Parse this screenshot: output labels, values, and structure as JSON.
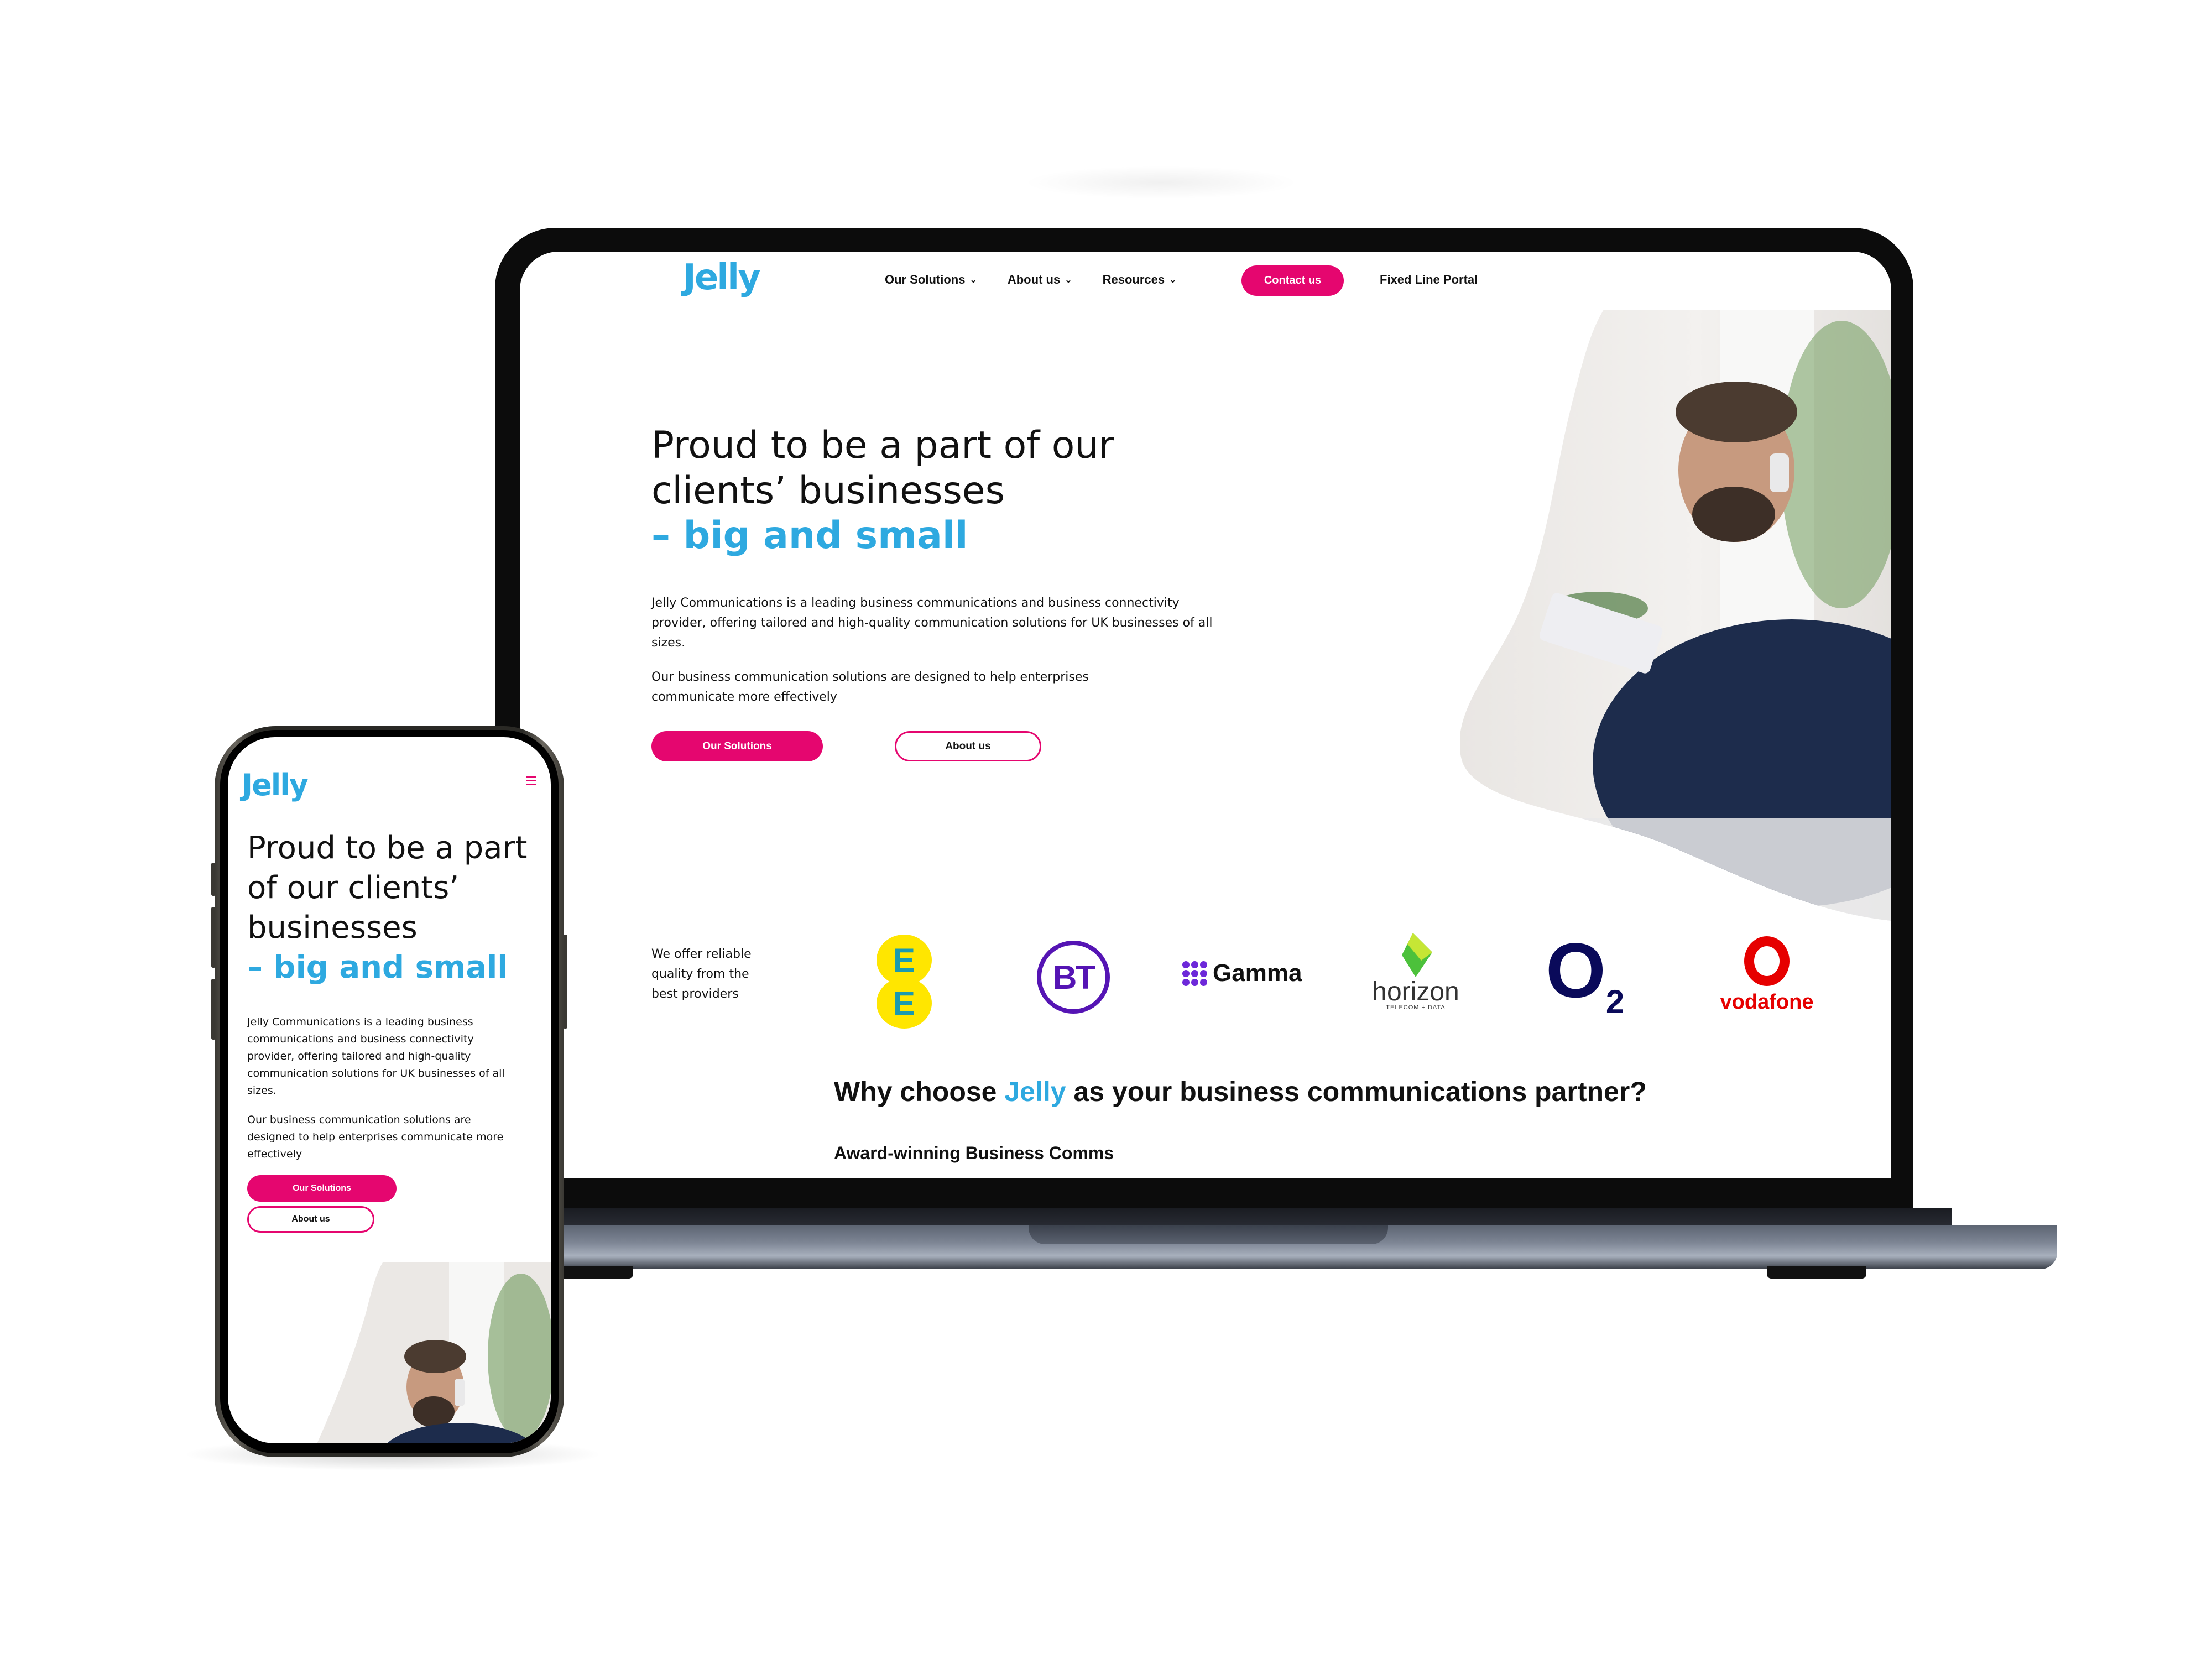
{
  "brand": {
    "name": "Jelly",
    "accent_color": "#2ea9e0",
    "primary_color": "#e5066f"
  },
  "desktop": {
    "nav": {
      "items": [
        {
          "label": "Our Solutions",
          "icon": "chevron-down-icon"
        },
        {
          "label": "About us",
          "icon": "chevron-down-icon"
        },
        {
          "label": "Resources",
          "icon": "chevron-down-icon"
        }
      ],
      "contact_label": "Contact us",
      "portal_label": "Fixed Line Portal"
    },
    "hero": {
      "title_line1": "Proud to be a part of our",
      "title_line2": "clients’ businesses",
      "title_accent": "– big and small",
      "para1": "Jelly Communications is a leading business communications and business connectivity provider, offering tailored and high-quality communication solutions for UK businesses of all sizes.",
      "para2": "Our business communication solutions are designed to help enterprises communicate more effectively",
      "primary_button": "Our Solutions",
      "secondary_button": "About us"
    },
    "providers": {
      "intro": "We offer reliable quality from the best providers",
      "logos": [
        {
          "name": "EE",
          "text": "E"
        },
        {
          "name": "BT",
          "text": "BT"
        },
        {
          "name": "Gamma",
          "text": "Gamma"
        },
        {
          "name": "horizon",
          "text": "horizon",
          "subtext": "TELECOM + DATA"
        },
        {
          "name": "O2",
          "text": "O",
          "sub": "2"
        },
        {
          "name": "vodafone",
          "text": "vodafone"
        }
      ]
    },
    "why": {
      "prefix": "Why choose ",
      "brand": "Jelly",
      "suffix": " as your business communications partner?",
      "subheading": "Award-winning Business Comms"
    }
  },
  "mobile": {
    "menu_icon": "hamburger-menu-icon",
    "hero": {
      "title_line1": "Proud to be a part",
      "title_line2": "of our clients’",
      "title_line3": "businesses",
      "title_accent": "– big and small",
      "para1": "Jelly Communications is a leading business communications and business connectivity provider, offering tailored and high-quality communication solutions for UK businesses of all sizes.",
      "para2": "Our business communication solutions are designed to help enterprises communicate more effectively",
      "primary_button": "Our Solutions",
      "secondary_button": "About us"
    }
  }
}
